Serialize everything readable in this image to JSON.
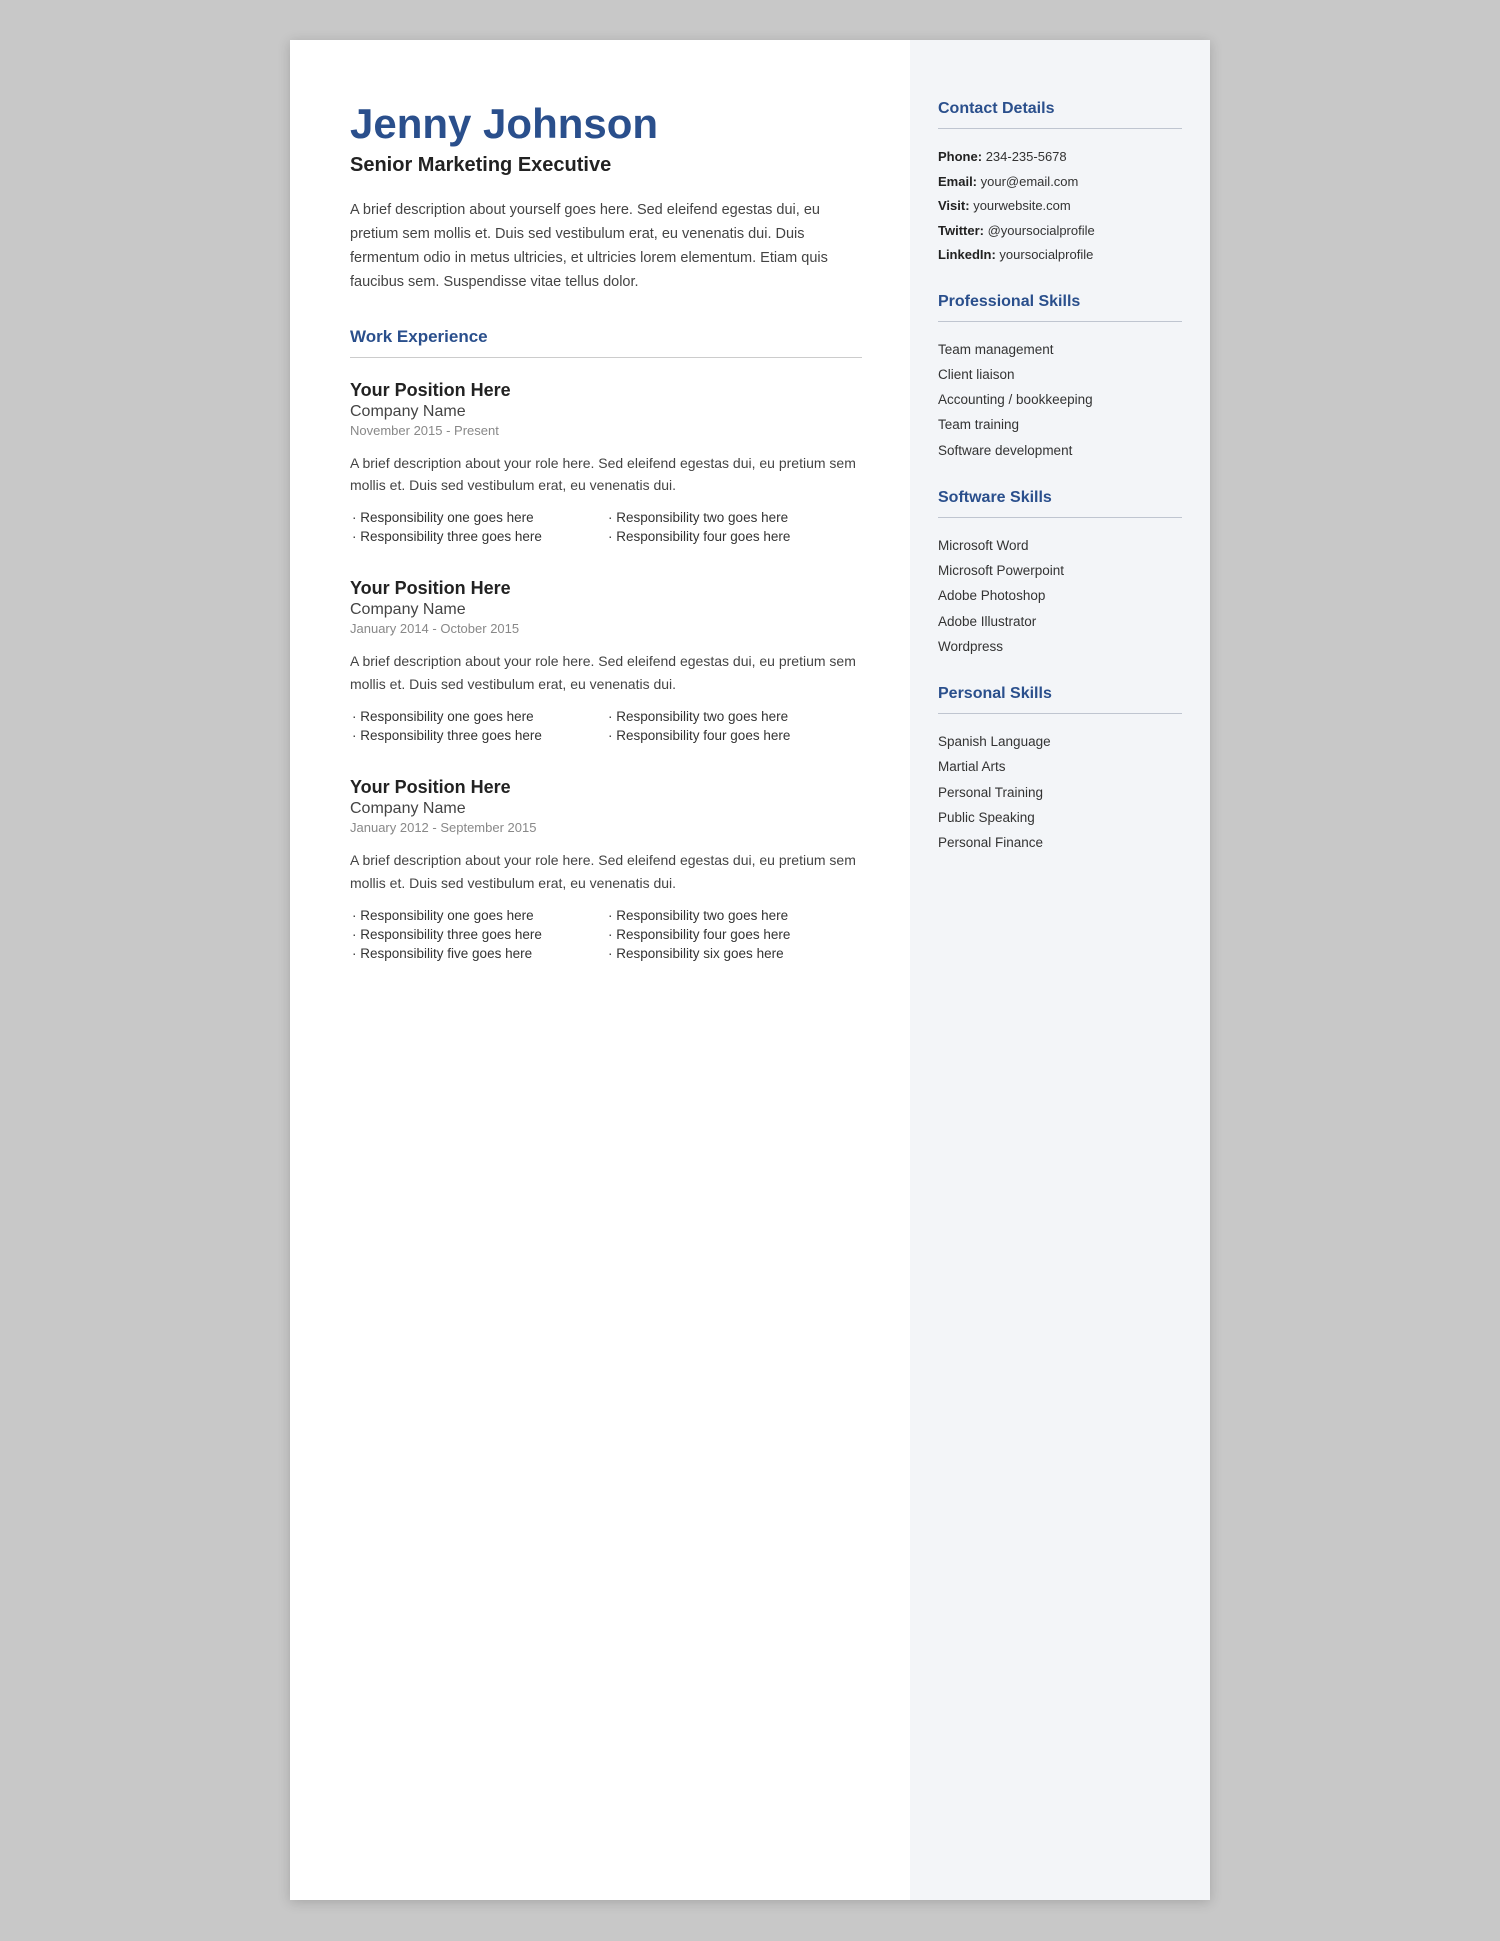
{
  "header": {
    "name": "Jenny Johnson",
    "title": "Senior Marketing Executive",
    "bio": "A brief description about yourself goes here. Sed eleifend egestas dui, eu pretium sem mollis et. Duis sed vestibulum erat, eu venenatis dui. Duis fermentum odio in metus ultricies, et ultricies lorem elementum. Etiam quis faucibus sem. Suspendisse vitae tellus dolor."
  },
  "sections": {
    "work_experience_label": "Work Experience"
  },
  "jobs": [
    {
      "position": "Your Position Here",
      "company": "Company Name",
      "dates": "November 2015 - Present",
      "description": "A brief description about your role here. Sed eleifend egestas dui, eu pretium sem mollis et. Duis sed vestibulum erat, eu venenatis dui.",
      "responsibilities_left": [
        "Responsibility one goes here",
        "Responsibility three goes here"
      ],
      "responsibilities_right": [
        "Responsibility two goes here",
        "Responsibility four goes here"
      ]
    },
    {
      "position": "Your Position Here",
      "company": "Company Name",
      "dates": "January 2014 - October 2015",
      "description": "A brief description about your role here. Sed eleifend egestas dui, eu pretium sem mollis et. Duis sed vestibulum erat, eu venenatis dui.",
      "responsibilities_left": [
        "Responsibility one goes here",
        "Responsibility three goes here"
      ],
      "responsibilities_right": [
        "Responsibility two goes here",
        "Responsibility four goes here"
      ]
    },
    {
      "position": "Your Position Here",
      "company": "Company Name",
      "dates": "January 2012 - September 2015",
      "description": "A brief description about your role here. Sed eleifend egestas dui, eu pretium sem mollis et. Duis sed vestibulum erat, eu venenatis dui.",
      "responsibilities_left": [
        "Responsibility one goes here",
        "Responsibility three goes here",
        "Responsibility five goes here"
      ],
      "responsibilities_right": [
        "Responsibility two goes here",
        "Responsibility four goes here",
        "Responsibility six goes here"
      ]
    }
  ],
  "sidebar": {
    "contact_heading": "Contact Details",
    "contact": {
      "phone_label": "Phone:",
      "phone": "234-235-5678",
      "email_label": "Email:",
      "email": "your@email.com",
      "visit_label": "Visit:",
      "visit": " yourwebsite.com",
      "twitter_label": "Twitter:",
      "twitter": "@yoursocialprofile",
      "linkedin_label": "LinkedIn:",
      "linkedin": "yoursocialprofile"
    },
    "professional_skills_heading": "Professional Skills",
    "professional_skills": [
      "Team management",
      "Client liaison",
      "Accounting / bookkeeping",
      "Team training",
      "Software development"
    ],
    "software_skills_heading": "Software Skills",
    "software_skills": [
      "Microsoft Word",
      "Microsoft Powerpoint",
      "Adobe Photoshop",
      "Adobe Illustrator",
      "Wordpress"
    ],
    "personal_skills_heading": "Personal Skills",
    "personal_skills": [
      "Spanish Language",
      "Martial Arts",
      "Personal Training",
      "Public Speaking",
      "Personal Finance"
    ]
  }
}
